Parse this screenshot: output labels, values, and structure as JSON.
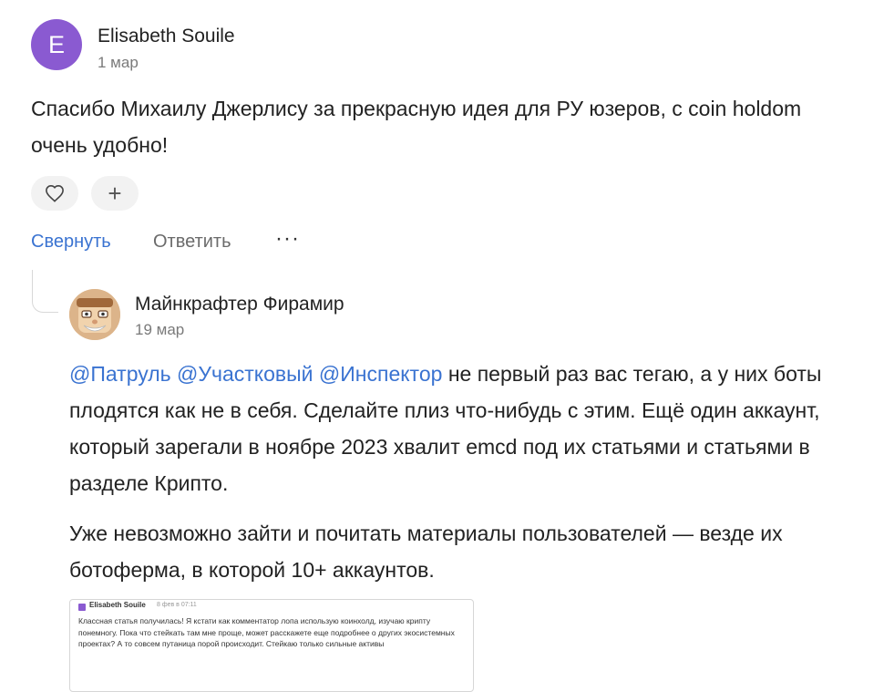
{
  "top_comment": {
    "avatar_letter": "E",
    "avatar_color": "#8a5ad1",
    "author": "Elisabeth Souile",
    "date": "1 мар",
    "text": "Спасибо Михаилу Джерлису за прекрасную идея для РУ юзеров, с coin holdom очень удобно!",
    "actions": {
      "collapse": "Свернуть",
      "reply": "Ответить",
      "more": "···"
    },
    "reactions": {
      "like_icon": "heart-icon",
      "add_icon": "plus-icon",
      "add_glyph": "+"
    }
  },
  "reply": {
    "avatar_icon": "cartoon-face-avatar",
    "author": "Майнкрафтер Фирамир",
    "date": "19 мар",
    "mentions": [
      "@Патруль",
      "@Участковый",
      "@Инспектор"
    ],
    "paragraph1_rest": "не первый раз вас тегаю, а у них боты плодятся как не в себя. Сделайте плиз что-нибудь с этим. Ещё один аккаунт, который зарегали в ноябре 2023 хвалит emcd под их статьями и статьями в разделе Крипто.",
    "paragraph2": "Уже невозможно зайти и почитать материалы пользователей — везде их ботоферма, в которой 10+ аккаунтов.",
    "attachment": {
      "author": "Elisabeth Souile",
      "date": "8 фев в 07:11",
      "text": "Классная статья получилась! Я кстати как комментатор лопа использую коинхолд, изучаю крипту понемногу. Пока что стейкать там мне проще, может расскажете еще подробнее о других экосистемных проектах? А то совсем путаница порой происходит. Стейкаю только сильные активы"
    }
  },
  "colors": {
    "link": "#3a73d1",
    "muted": "#7a7a7a"
  }
}
